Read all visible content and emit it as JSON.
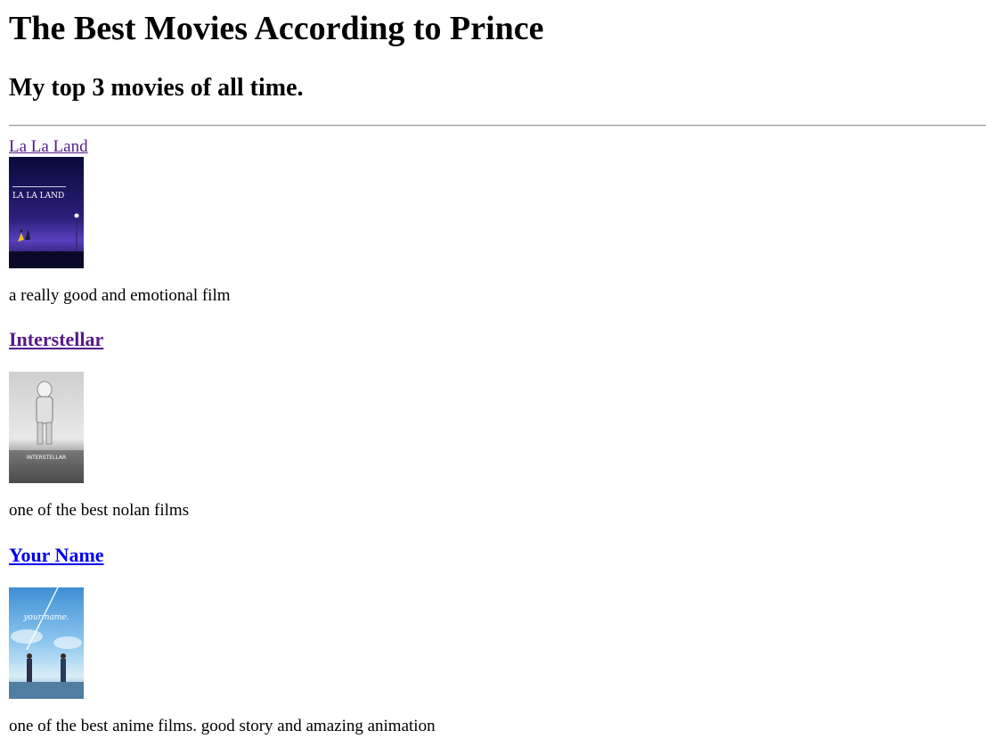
{
  "page": {
    "title": "The Best Movies According to Prince",
    "subtitle": "My top 3 movies of all time."
  },
  "movies": [
    {
      "title": "La La Land",
      "description": "a really good and emotional film",
      "poster_text": "LA LA LAND"
    },
    {
      "title": "Interstellar",
      "description": "one of the best nolan films",
      "poster_text": "INTERSTELLAR"
    },
    {
      "title": "Your Name",
      "description": "one of the best anime films. good story and amazing animation",
      "poster_text": "your name."
    }
  ],
  "colors": {
    "visited_link": "#551a8b",
    "unvisited_link": "#0000ee"
  }
}
